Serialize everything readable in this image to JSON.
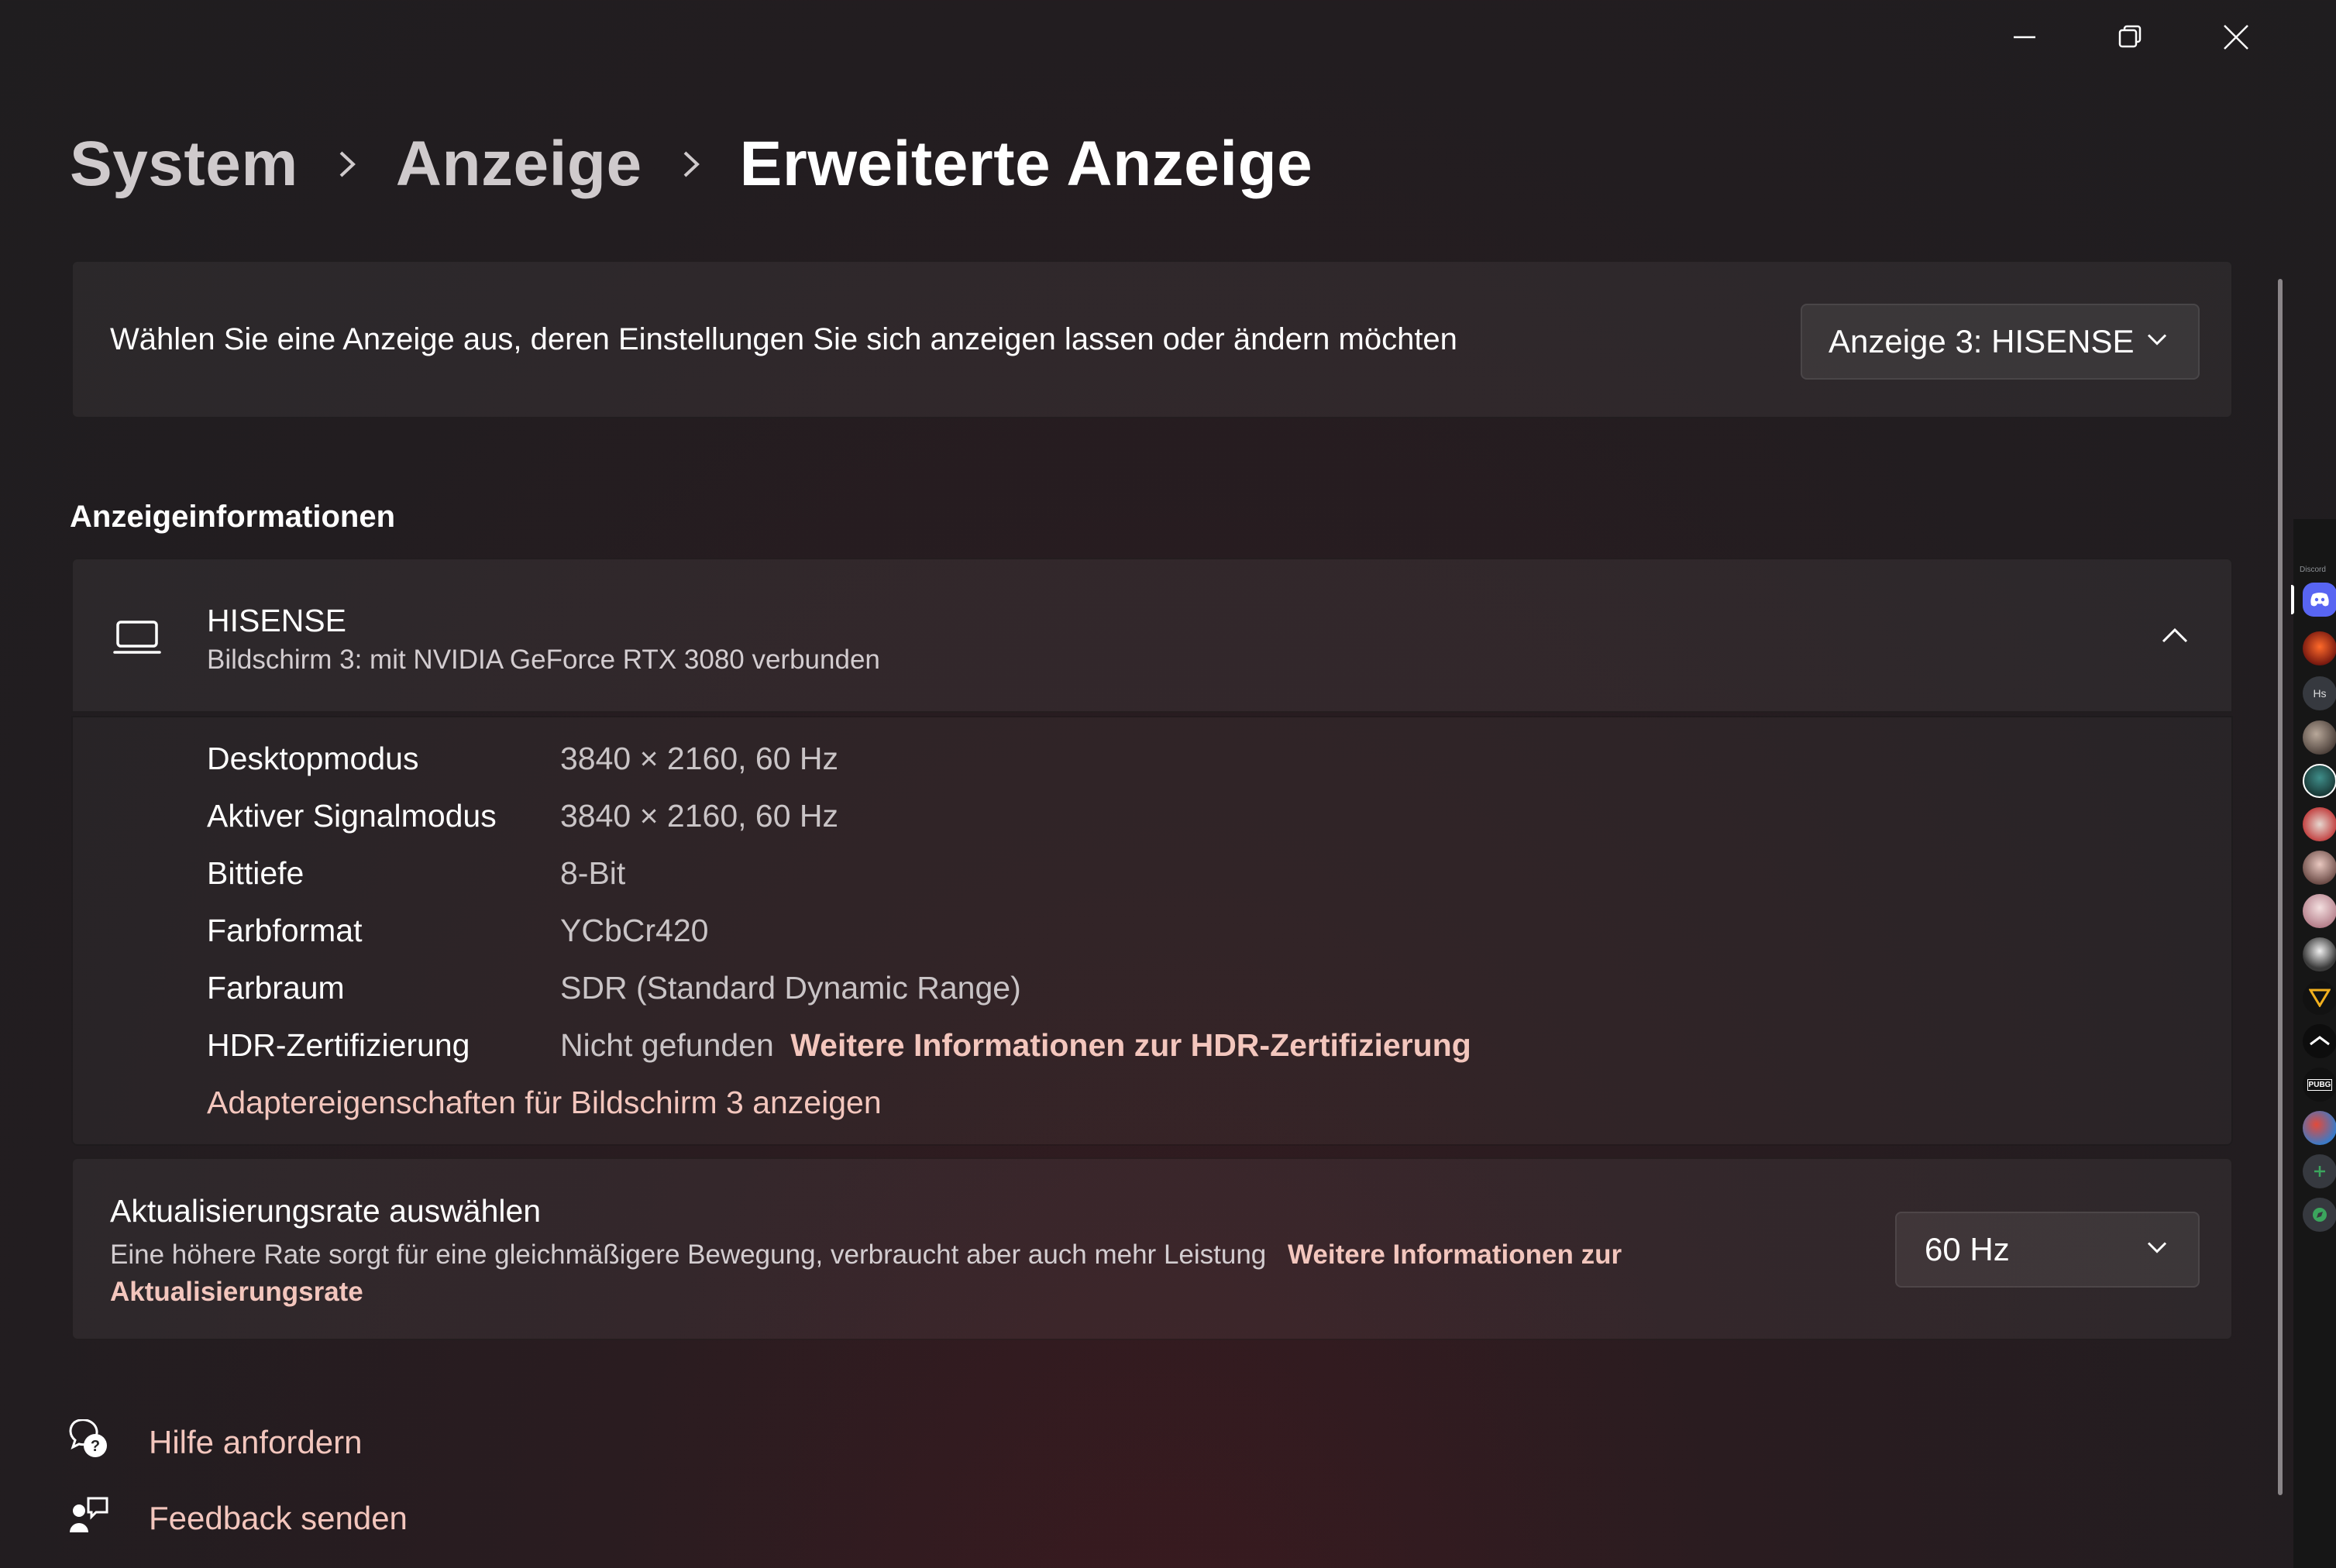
{
  "window": {
    "caption_buttons": [
      "minimize-icon",
      "restore-icon",
      "close-icon"
    ]
  },
  "breadcrumb": {
    "items": [
      "System",
      "Anzeige"
    ],
    "current": "Erweiterte Anzeige"
  },
  "display_select": {
    "prompt": "Wählen Sie eine Anzeige aus, deren Einstellungen Sie sich anzeigen lassen oder ändern möchten",
    "selected": "Anzeige 3: HISENSE"
  },
  "display_info": {
    "section_title": "Anzeigeinformationen",
    "name": "HISENSE",
    "subtitle": "Bildschirm 3: mit NVIDIA GeForce RTX 3080 verbunden",
    "rows": [
      {
        "label": "Desktopmodus",
        "value": "3840 × 2160, 60 Hz"
      },
      {
        "label": "Aktiver Signalmodus",
        "value": "3840 × 2160, 60 Hz"
      },
      {
        "label": "Bittiefe",
        "value": "8-Bit"
      },
      {
        "label": "Farbformat",
        "value": "YCbCr420"
      },
      {
        "label": "Farbraum",
        "value": "SDR (Standard Dynamic Range)"
      }
    ],
    "hdr_label": "HDR-Zertifizierung",
    "hdr_value": "Nicht gefunden",
    "hdr_link": "Weitere Informationen zur HDR-Zertifizierung",
    "adapter_link": "Adaptereigenschaften für Bildschirm 3 anzeigen"
  },
  "refresh_rate": {
    "title": "Aktualisierungsrate auswählen",
    "description": "Eine höhere Rate sorgt für eine gleichmäßigere Bewegung, verbraucht aber auch mehr Leistung",
    "link_line1": "Weitere Informationen zur",
    "link_line2": "Aktualisierungsrate",
    "selected": "60 Hz"
  },
  "footer": {
    "help": "Hilfe anfordern",
    "feedback": "Feedback senden"
  },
  "discord_rail": {
    "label": "Discord",
    "hs_label": "Hs",
    "pubg_label": "PUBG"
  },
  "colors": {
    "accent_link": "#f3c6bd",
    "discord": "#5865f2"
  }
}
